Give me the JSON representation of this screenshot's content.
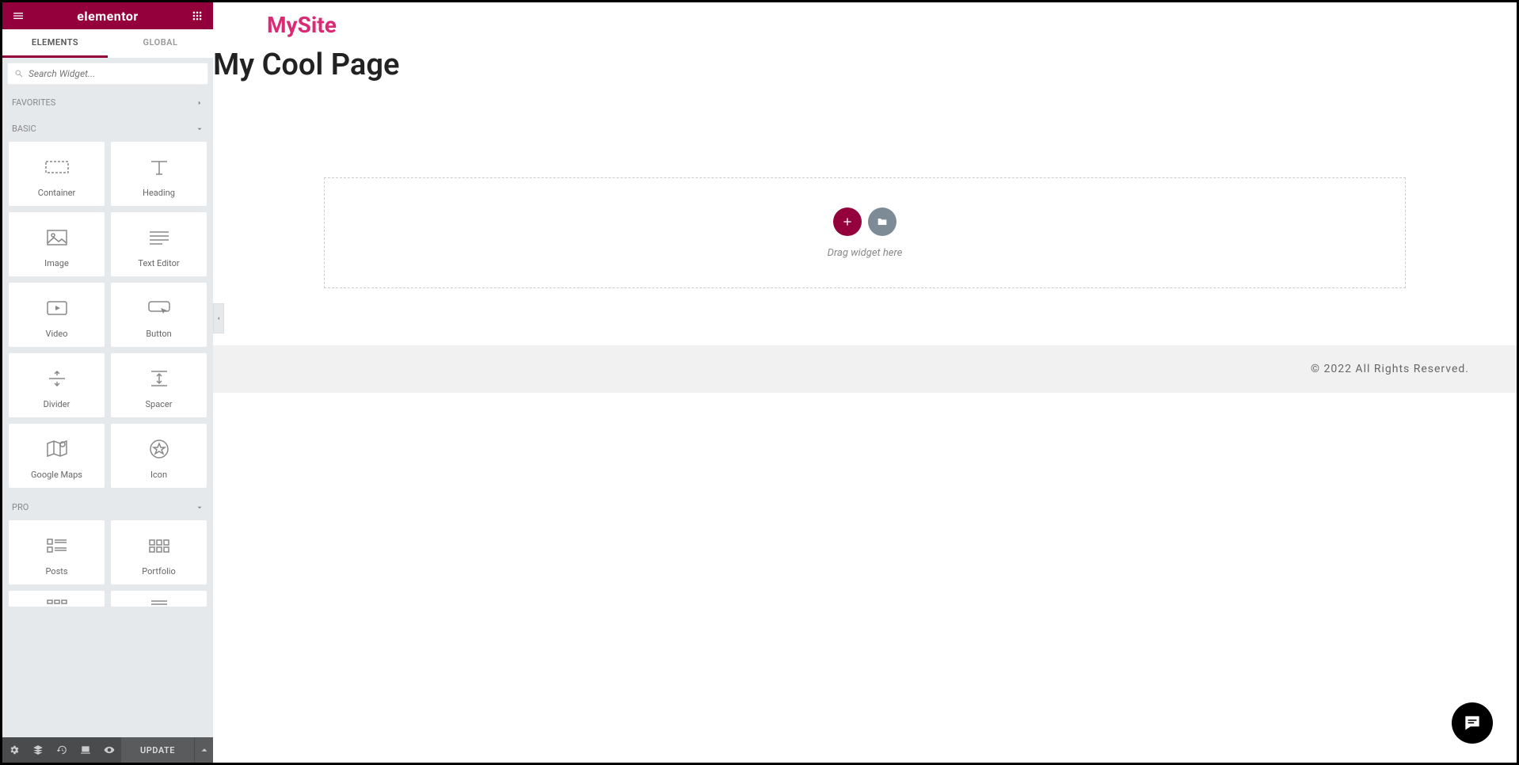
{
  "header": {
    "logo": "elementor"
  },
  "tabs": {
    "elements": "ELEMENTS",
    "global": "GLOBAL"
  },
  "search": {
    "placeholder": "Search Widget..."
  },
  "categories": {
    "favorites": "FAVORITES",
    "basic": "BASIC",
    "pro": "PRO"
  },
  "widgets": {
    "basic": [
      {
        "label": "Container"
      },
      {
        "label": "Heading"
      },
      {
        "label": "Image"
      },
      {
        "label": "Text Editor"
      },
      {
        "label": "Video"
      },
      {
        "label": "Button"
      },
      {
        "label": "Divider"
      },
      {
        "label": "Spacer"
      },
      {
        "label": "Google Maps"
      },
      {
        "label": "Icon"
      }
    ],
    "pro": [
      {
        "label": "Posts"
      },
      {
        "label": "Portfolio"
      }
    ]
  },
  "footer_buttons": {
    "update": "UPDATE"
  },
  "canvas": {
    "site_title": "MySite",
    "page_title": "My Cool Page",
    "drop_text": "Drag widget here",
    "footer": "© 2022 All Rights Reserved."
  }
}
